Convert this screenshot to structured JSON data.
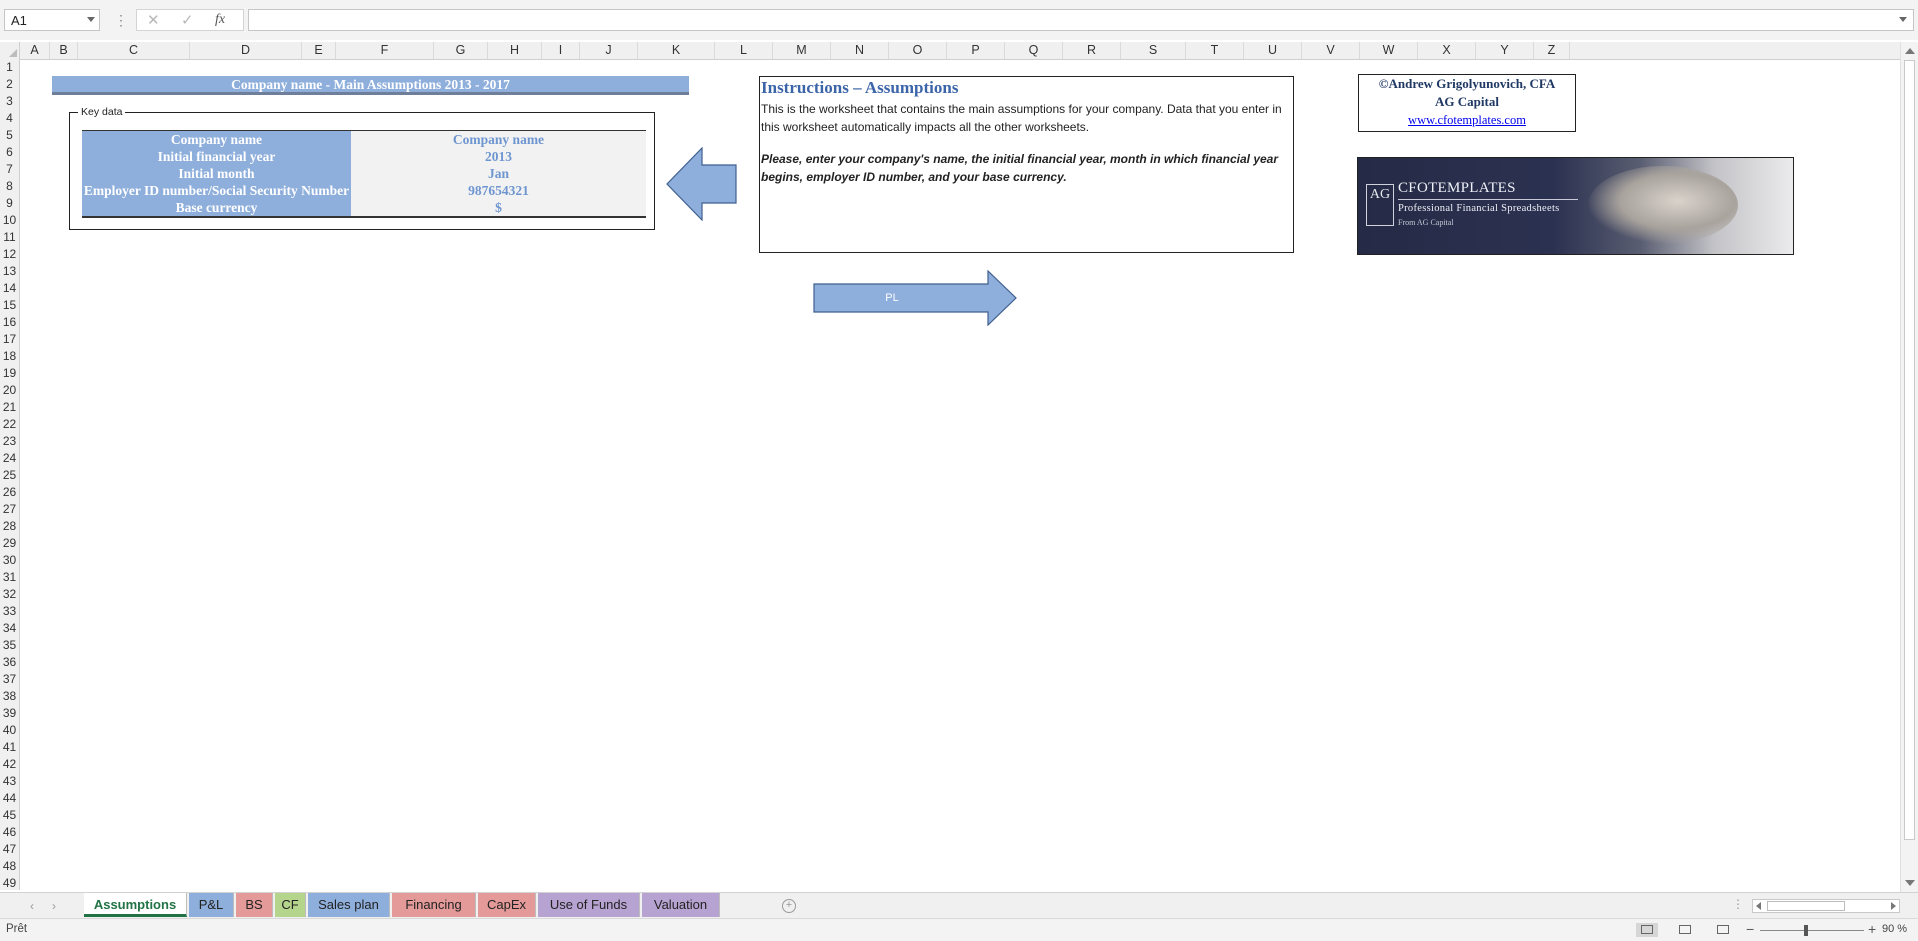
{
  "formula_bar": {
    "name_box": "A1",
    "fx_label": "fx",
    "cancel_glyph": "✕",
    "enter_glyph": "✓",
    "formula": ""
  },
  "columns": [
    "A",
    "B",
    "C",
    "D",
    "E",
    "F",
    "G",
    "H",
    "I",
    "J",
    "K",
    "L",
    "M",
    "N",
    "O",
    "P",
    "Q",
    "R",
    "S",
    "T",
    "U",
    "V",
    "W",
    "X",
    "Y",
    "Z"
  ],
  "row_count": 49,
  "sheet": {
    "title": "Company name - Main Assumptions 2013 - 2017",
    "key_data": {
      "group_label": "Key data",
      "rows": [
        {
          "label": "Company name",
          "value": "Company name"
        },
        {
          "label": "Initial financial year",
          "value": "2013"
        },
        {
          "label": "Initial month",
          "value": "Jan"
        },
        {
          "label": "Employer ID number/Social Security Number",
          "value": "987654321"
        },
        {
          "label": "Base currency",
          "value": "$"
        }
      ]
    },
    "instructions": {
      "title": "Instructions – Assumptions",
      "body": "This is the worksheet that contains the main assumptions for your company. Data that you enter in this worksheet automatically impacts all the other worksheets.",
      "note": "Please, enter your company's name, the initial financial year, month in which financial year begins, employer ID number, and your base currency."
    },
    "credit": {
      "author": "©Andrew Grigolyunovich, CFA",
      "company": "AG Capital",
      "link": "www.cfotemplates.com"
    },
    "banner": {
      "logo_text": "AG",
      "brand": "CFOTEMPLATES",
      "tagline": "Professional Financial Spreadsheets",
      "from": "From AG Capital"
    },
    "nav_arrow_label": "PL",
    "shape_fill_color": "#8eaedb",
    "header_color": "#8eaedb",
    "value_text_color": "#6e96d0"
  },
  "tabs": [
    {
      "label": "Assumptions",
      "color": "#ffffff",
      "active": true
    },
    {
      "label": "P&L",
      "color": "#8eaedb"
    },
    {
      "label": "BS",
      "color": "#e59a9a"
    },
    {
      "label": "CF",
      "color": "#b5d58c"
    },
    {
      "label": "Sales plan",
      "color": "#8eaedb"
    },
    {
      "label": "Financing",
      "color": "#e59a9a"
    },
    {
      "label": "CapEx",
      "color": "#e59a9a"
    },
    {
      "label": "Use of Funds",
      "color": "#b7a3d1"
    },
    {
      "label": "Valuation",
      "color": "#b7a3d1"
    }
  ],
  "status_bar": {
    "ready": "Prêt",
    "zoom": "90 %",
    "zoom_level": 0.42
  }
}
